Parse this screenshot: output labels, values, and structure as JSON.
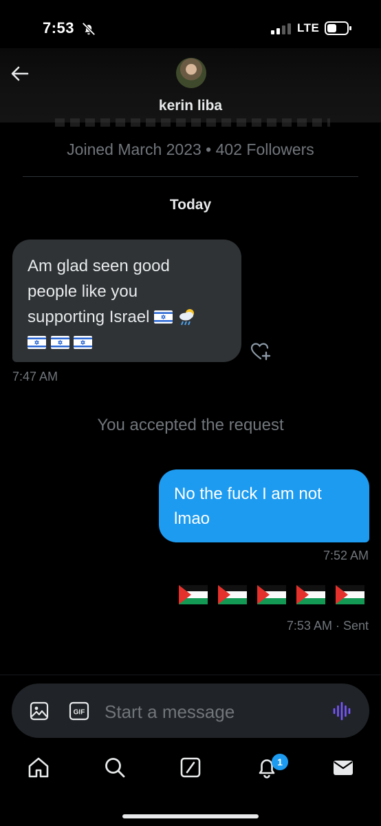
{
  "status_bar": {
    "time": "7:53",
    "network": "LTE"
  },
  "header": {
    "contact_name": "kerin liba"
  },
  "profile_summary": {
    "joined_line": "Joined March 2023 • 402 Followers"
  },
  "conversation": {
    "day_label": "Today",
    "incoming": {
      "lines": [
        "Am glad seen good",
        "people like you",
        "supporting Israel"
      ],
      "emoji_note": "Israeli flags and cloud with sun/rain emoji",
      "time": "7:47 AM"
    },
    "system_message": "You accepted the request",
    "outgoing": {
      "lines": [
        "No the fuck I am not",
        "lmao"
      ],
      "time": "7:52 AM"
    },
    "outgoing_emoji": {
      "flag_count": 5,
      "time": "7:53 AM",
      "status": "· Sent"
    }
  },
  "composer": {
    "placeholder": "Start a message"
  },
  "bottom_nav": {
    "notifications_badge": "1"
  },
  "colors": {
    "background": "#000000",
    "incoming_bubble": "#2f3336",
    "outgoing_bubble": "#1d9bf0",
    "muted_text": "#71767b",
    "voice_accent": "#7856ff"
  },
  "icons": [
    "bell-slash-icon",
    "signal-icon",
    "battery-icon",
    "back-arrow-icon",
    "add-reaction-icon",
    "image-icon",
    "gif-icon",
    "voice-message-icon",
    "home-icon",
    "search-icon",
    "grok-icon",
    "notifications-bell-icon",
    "messages-envelope-icon"
  ]
}
